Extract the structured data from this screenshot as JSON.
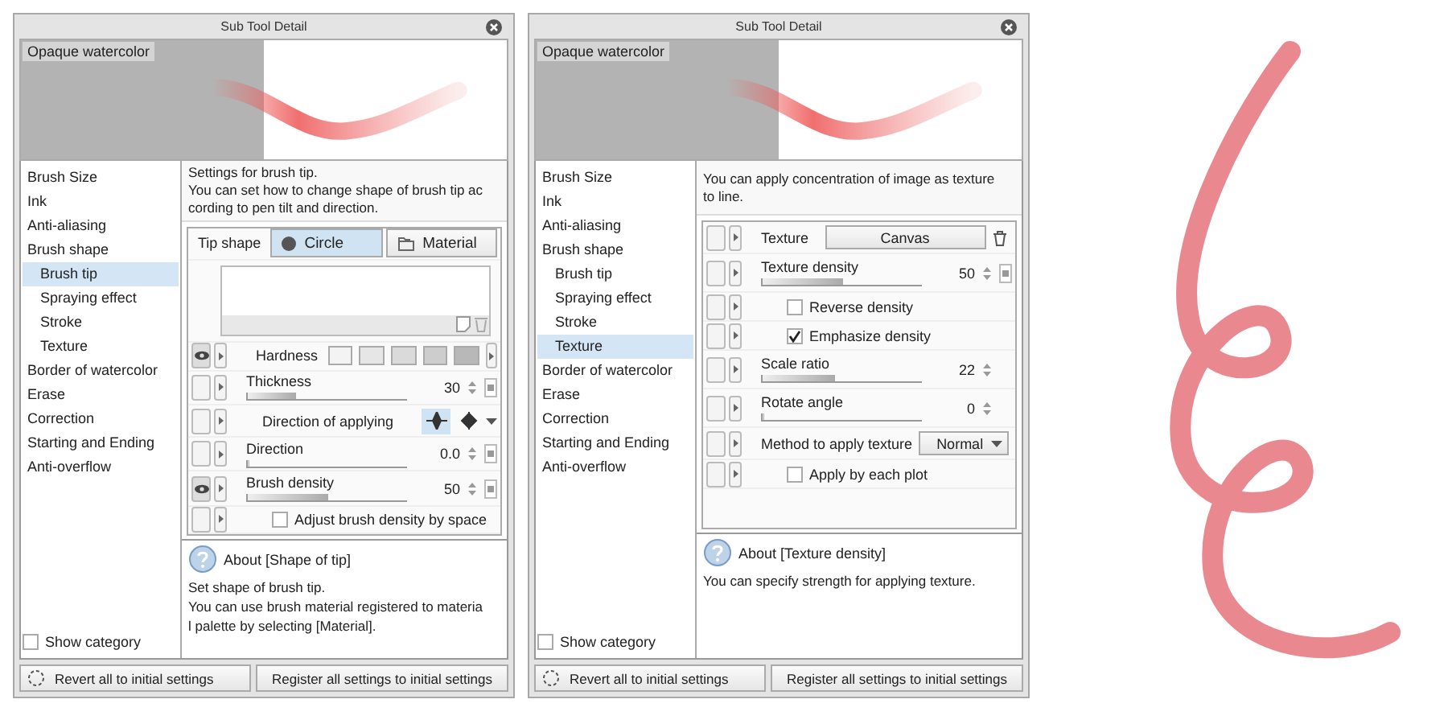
{
  "panels": [
    {
      "title": "Sub Tool Detail",
      "preview_label": "Opaque watercolor",
      "categories": [
        {
          "label": "Brush Size",
          "selected": false
        },
        {
          "label": "Ink",
          "selected": false
        },
        {
          "label": "Anti-aliasing",
          "selected": false
        },
        {
          "label": "Brush shape",
          "selected": false,
          "children": [
            {
              "label": "Brush tip",
              "selected": true
            },
            {
              "label": "Spraying effect",
              "selected": false
            },
            {
              "label": "Stroke",
              "selected": false
            },
            {
              "label": "Texture",
              "selected": false
            }
          ]
        },
        {
          "label": "Border of watercolor",
          "selected": false
        },
        {
          "label": "Erase",
          "selected": false
        },
        {
          "label": "Correction",
          "selected": false
        },
        {
          "label": "Starting and Ending",
          "selected": false
        },
        {
          "label": "Anti-overflow",
          "selected": false
        }
      ],
      "show_category": {
        "label": "Show category",
        "checked": false
      },
      "description": [
        "Settings for brush tip.",
        "You can set how to change shape of brush tip ac",
        "cording to pen tilt and direction."
      ],
      "settings": [
        {
          "kind": "tip_shape",
          "label": "Tip shape",
          "options": [
            {
              "label": "Circle",
              "selected": true
            },
            {
              "label": "Material",
              "selected": false
            }
          ]
        },
        {
          "kind": "material_list"
        },
        {
          "kind": "segments",
          "label": "Hardness",
          "eye": true
        },
        {
          "kind": "slider",
          "label": "Thickness",
          "eye": false,
          "value": "30",
          "level": 0.3,
          "pressure": true
        },
        {
          "kind": "direction",
          "label": "Direction of applying",
          "eye": false,
          "options": [
            {
              "selected": true
            },
            {
              "selected": false
            }
          ]
        },
        {
          "kind": "slider",
          "label": "Direction",
          "eye": false,
          "value": "0.0",
          "level": 0,
          "pressure": true
        },
        {
          "kind": "slider",
          "label": "Brush density",
          "eye": true,
          "value": "50",
          "level": 0.5,
          "pressure": true
        },
        {
          "kind": "checkbox",
          "label": "Adjust brush density by space",
          "eye": false,
          "checked": false
        }
      ],
      "about": {
        "title": "About [Shape of tip]",
        "lines": [
          "Set shape of brush tip.",
          "You can use brush material registered to materia",
          "l palette by selecting [Material]."
        ]
      },
      "buttons": [
        "Revert all to initial settings",
        "Register all settings to initial settings"
      ]
    },
    {
      "title": "Sub Tool Detail",
      "preview_label": "Opaque watercolor",
      "categories": [
        {
          "label": "Brush Size",
          "selected": false
        },
        {
          "label": "Ink",
          "selected": false
        },
        {
          "label": "Anti-aliasing",
          "selected": false
        },
        {
          "label": "Brush shape",
          "selected": false,
          "children": [
            {
              "label": "Brush tip",
              "selected": false
            },
            {
              "label": "Spraying effect",
              "selected": false
            },
            {
              "label": "Stroke",
              "selected": false
            },
            {
              "label": "Texture",
              "selected": true
            }
          ]
        },
        {
          "label": "Border of watercolor",
          "selected": false
        },
        {
          "label": "Erase",
          "selected": false
        },
        {
          "label": "Correction",
          "selected": false
        },
        {
          "label": "Starting and Ending",
          "selected": false
        },
        {
          "label": "Anti-overflow",
          "selected": false
        }
      ],
      "show_category": {
        "label": "Show category",
        "checked": false
      },
      "description": [
        "You can apply concentration of image as texture",
        "to line."
      ],
      "settings": [
        {
          "kind": "select",
          "label": "Texture",
          "eye": false,
          "value": "Canvas"
        },
        {
          "kind": "slider",
          "label": "Texture density",
          "eye": false,
          "value": "50",
          "level": 0.5,
          "pressure": true
        },
        {
          "kind": "checkbox",
          "label": "Reverse density",
          "eye": false,
          "checked": false
        },
        {
          "kind": "checkbox",
          "label": "Emphasize density",
          "eye": false,
          "checked": true
        },
        {
          "kind": "slider",
          "label": "Scale ratio",
          "eye": false,
          "value": "22",
          "level": 0.45,
          "pressure": false
        },
        {
          "kind": "slider",
          "label": "Rotate angle",
          "eye": false,
          "value": "0",
          "level": 0,
          "pressure": false
        },
        {
          "kind": "dropdown",
          "label": "Method to apply texture",
          "eye": false,
          "value": "Normal"
        },
        {
          "kind": "checkbox",
          "label": "Apply by each plot",
          "eye": false,
          "checked": false
        }
      ],
      "about": {
        "title": "About [Texture density]",
        "lines": [
          "You can specify strength for applying texture."
        ]
      },
      "buttons": [
        "Revert all to initial settings",
        "Register all settings to initial settings"
      ]
    }
  ]
}
